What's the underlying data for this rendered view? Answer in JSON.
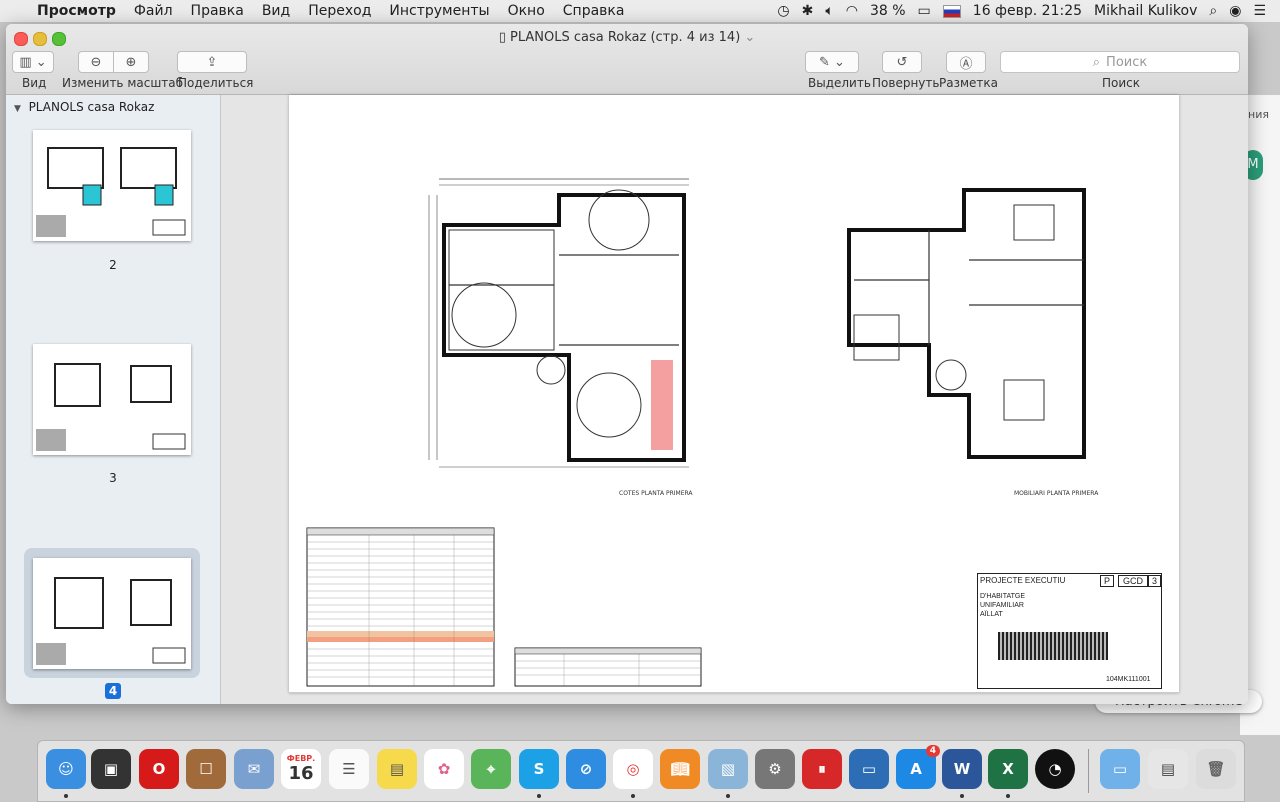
{
  "menubar": {
    "app": "Просмотр",
    "items": [
      "Файл",
      "Правка",
      "Вид",
      "Переход",
      "Инструменты",
      "Окно",
      "Справка"
    ],
    "battery": "38 %",
    "datetime": "16 февр.  21:25",
    "user": "Mikhail Kulikov"
  },
  "window": {
    "title": "PLANOLS casa Rokaz (стр. 4 из 14)",
    "toolbar": {
      "view_label": "Вид",
      "zoom_label": "Изменить масштаб",
      "share_label": "Поделиться",
      "highlight_label": "Выделить",
      "rotate_label": "Повернуть",
      "markup_label": "Разметка",
      "search_placeholder": "Поиск",
      "search_label": "Поиск"
    }
  },
  "sidebar": {
    "document_name": "PLANOLS casa Rokaz",
    "pages": [
      {
        "number": "2",
        "selected": false
      },
      {
        "number": "3",
        "selected": false
      },
      {
        "number": "4",
        "selected": true
      }
    ]
  },
  "document": {
    "plan_left_label": "COTES PLANTA PRIMERA",
    "plan_right_label": "MOBILIARI PLANTA PRIMERA",
    "stamp_left": "PROJECTE EXECUTIU",
    "stamp_p": "P",
    "stamp_code": "GCD",
    "stamp_num": "3",
    "stamp_lines": [
      "D'HABITATGE",
      "UNIFAMILIAR",
      "AÏLLAT"
    ],
    "stamp_ref": "104MK111001"
  },
  "background": {
    "side_text": "ния",
    "avatar_letter": "M",
    "chrome_button": "Настроить Chrome"
  },
  "dock": {
    "calendar_month": "ФЕВР.",
    "calendar_day": "16",
    "appstore_badge": "4",
    "colors": {
      "finder": "#3b8fe0",
      "opera": "#d61a1a",
      "skype": "#1da1e6",
      "word": "#2b579a",
      "excel": "#1f7244"
    }
  }
}
